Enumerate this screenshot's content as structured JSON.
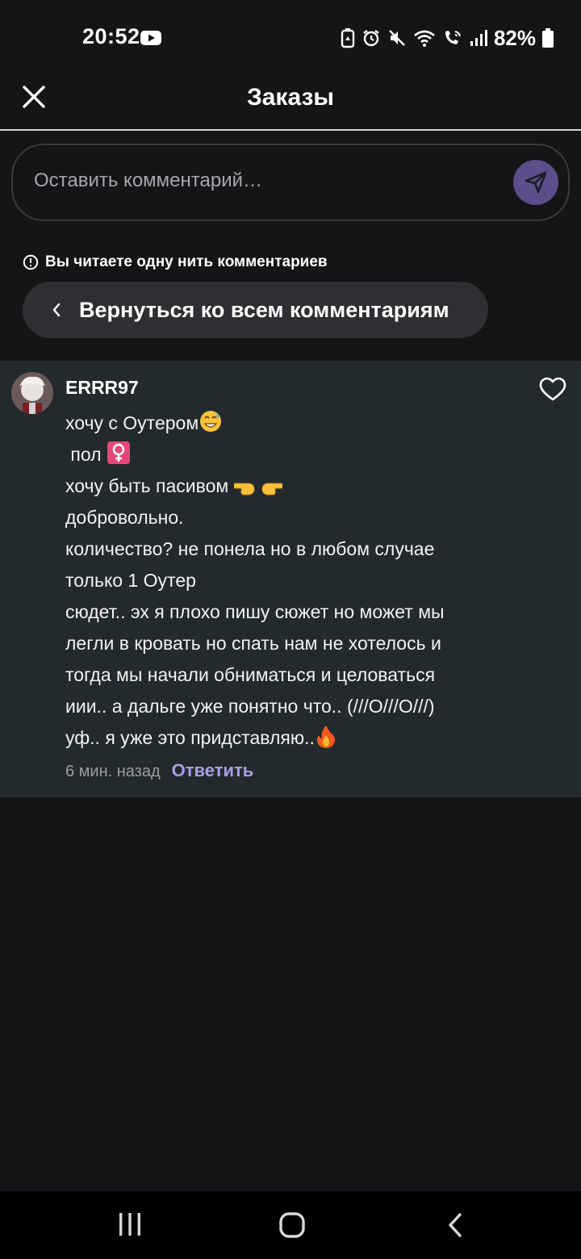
{
  "status_bar": {
    "time": "20:52",
    "battery": "82%",
    "icons": [
      "youtube-icon",
      "battery-saver-icon",
      "alarm-icon",
      "mute-icon",
      "wifi-icon",
      "wifi-calling-icon",
      "signal-icon",
      "battery-icon"
    ]
  },
  "header": {
    "title": "Заказы",
    "close_icon": "close-icon"
  },
  "comment_input": {
    "placeholder": "Оставить комментарий…",
    "send_icon": "send-icon",
    "accent": "#5b4e8a"
  },
  "thread": {
    "notice": "Вы читаете одну нить комментариев",
    "back_label": "Вернуться ко всем комментариям"
  },
  "comment": {
    "username": "ERRR97",
    "lines": [
      "хочу с Оутером",
      " пол ",
      "хочу быть пасивом ",
      "добровольно.",
      "количество? не понела но в любом случае",
      "только 1 Оутер",
      "сюдет.. эх я плохо пишу сюжет но может мы",
      "легли в кровать но спать нам не хотелось и",
      "тогда мы начали обниматься и целоваться",
      "иии.. а дальге уже понятно что.. (///O///O///)",
      "уф.. я уже это придставляю.."
    ],
    "emojis": [
      "grinning-sweat-emoji",
      "female-sign-emoji",
      "pointing-hands-emoji",
      "fire-emoji"
    ],
    "timestamp": "6 мин. назад",
    "reply_label": "Ответить",
    "reply_color": "#a99ee8",
    "card_background": "#232a2d"
  },
  "nav_bar": {
    "buttons": [
      "recent-apps-icon",
      "home-icon",
      "back-icon"
    ]
  }
}
